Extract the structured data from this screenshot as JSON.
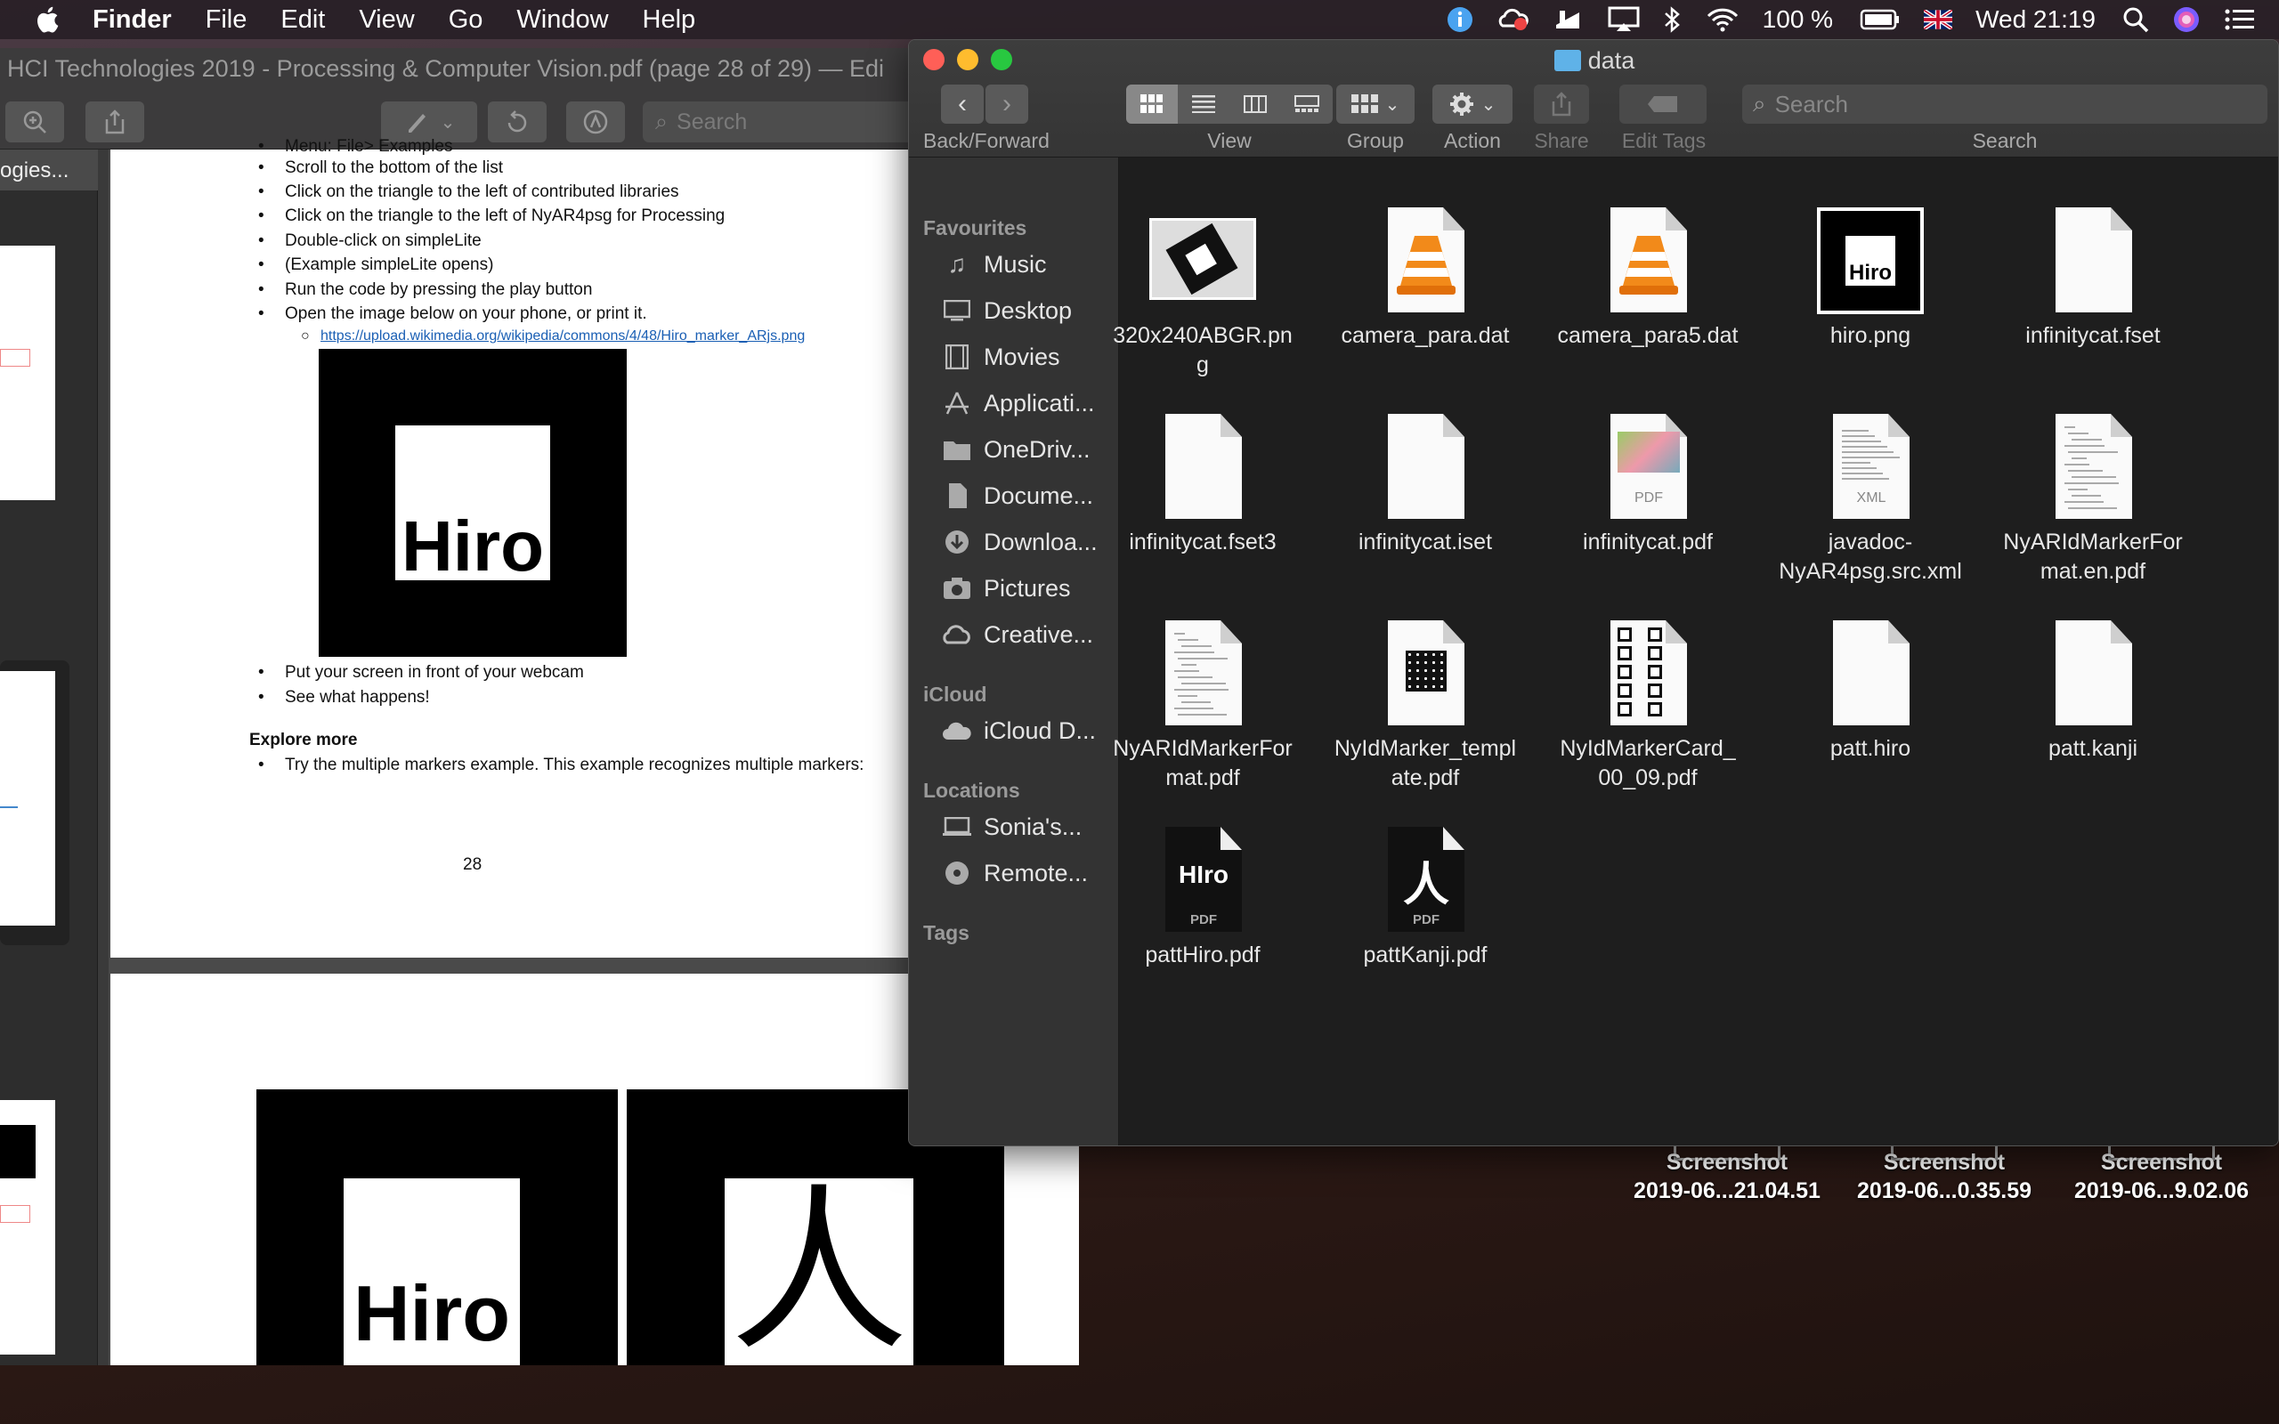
{
  "menubar": {
    "app": "Finder",
    "items": [
      "File",
      "Edit",
      "View",
      "Go",
      "Window",
      "Help"
    ],
    "battery": "100 %",
    "clock": "Wed 21:19"
  },
  "preview": {
    "title": "HCI Technologies 2019 - Processing & Computer Vision.pdf (page 28 of 29) — Edi",
    "search_placeholder": "Search",
    "sidebar_heading": "ogies...",
    "page": {
      "lines": [
        "Menu: File> Examples",
        "Scroll to the bottom of the list",
        "Click on the triangle to the left of contributed libraries",
        "Click on the triangle to the left of NyAR4psg for Processing",
        "Double-click on simpleLite",
        "(Example simpleLite opens)",
        "Run the code by pressing the play button",
        "Open the image below on your phone, or print it."
      ],
      "link": "https://upload.wikimedia.org/wikipedia/commons/4/48/Hiro_marker_ARjs.png",
      "marker_text": "Hiro",
      "after_lines": [
        "Put your screen in front of your webcam",
        "See what happens!"
      ],
      "explore_heading": "Explore more",
      "explore_line": "Try the multiple markers example. This example recognizes multiple markers:",
      "page_number": "28",
      "kanji": "人"
    }
  },
  "finder": {
    "title": "data",
    "toolbar": {
      "back_forward": "Back/Forward",
      "view": "View",
      "group": "Group",
      "action": "Action",
      "share": "Share",
      "edit_tags": "Edit Tags",
      "search": "Search",
      "search_placeholder": "Search"
    },
    "sidebar": {
      "favourites": "Favourites",
      "fav_items": [
        "Music",
        "Desktop",
        "Movies",
        "Applicati...",
        "OneDriv...",
        "Docume...",
        "Downloa...",
        "Pictures",
        "Creative..."
      ],
      "icloud": "iCloud",
      "icloud_items": [
        "iCloud D..."
      ],
      "locations": "Locations",
      "location_items": [
        "Sonia's...",
        "Remote..."
      ],
      "tags": "Tags"
    },
    "files": [
      {
        "line1": "320x240ABGR.pn",
        "line2": "g",
        "kind": "image-thumb"
      },
      {
        "line1": "camera_para.dat",
        "line2": "",
        "kind": "vlc"
      },
      {
        "line1": "camera_para5.dat",
        "line2": "",
        "kind": "vlc"
      },
      {
        "line1": "hiro.png",
        "line2": "",
        "kind": "hiro-thumb"
      },
      {
        "line1": "infinitycat.fset",
        "line2": "",
        "kind": "blank"
      },
      {
        "line1": "infinitycat.fset3",
        "line2": "",
        "kind": "blank"
      },
      {
        "line1": "infinitycat.iset",
        "line2": "",
        "kind": "blank"
      },
      {
        "line1": "infinitycat.pdf",
        "line2": "",
        "kind": "pdf-photo",
        "tag": "PDF"
      },
      {
        "line1": "javadoc-",
        "line2": "NyAR4psg.src.xml",
        "kind": "xml",
        "tag": "XML"
      },
      {
        "line1": "NyARIdMarkerFor",
        "line2": "mat.en.pdf",
        "kind": "text-doc"
      },
      {
        "line1": "NyARIdMarkerFor",
        "line2": "mat.pdf",
        "kind": "text-doc"
      },
      {
        "line1": "NyIdMarker_templ",
        "line2": "ate.pdf",
        "kind": "grid-doc"
      },
      {
        "line1": "NyIdMarkerCard_",
        "line2": "00_09.pdf",
        "kind": "cards-doc"
      },
      {
        "line1": "patt.hiro",
        "line2": "",
        "kind": "blank"
      },
      {
        "line1": "patt.kanji",
        "line2": "",
        "kind": "blank"
      },
      {
        "line1": "pattHiro.pdf",
        "line2": "",
        "kind": "black-pdf",
        "glyph": "HIro",
        "tag": "PDF"
      },
      {
        "line1": "pattKanji.pdf",
        "line2": "",
        "kind": "black-pdf",
        "glyph": "人",
        "tag": "PDF"
      }
    ]
  },
  "desktop": {
    "icons": [
      {
        "line1": "Screenshot",
        "line2": "2019-06...21.04.51"
      },
      {
        "line1": "Screenshot",
        "line2": "2019-06...0.35.59"
      },
      {
        "line1": "Screenshot",
        "line2": "2019-06...9.02.06"
      }
    ]
  },
  "colors": {
    "accent": "#5fb2e8",
    "close": "#ff5f57",
    "minimize": "#febc2e",
    "zoom": "#28c840",
    "link": "#1a5fb4"
  }
}
